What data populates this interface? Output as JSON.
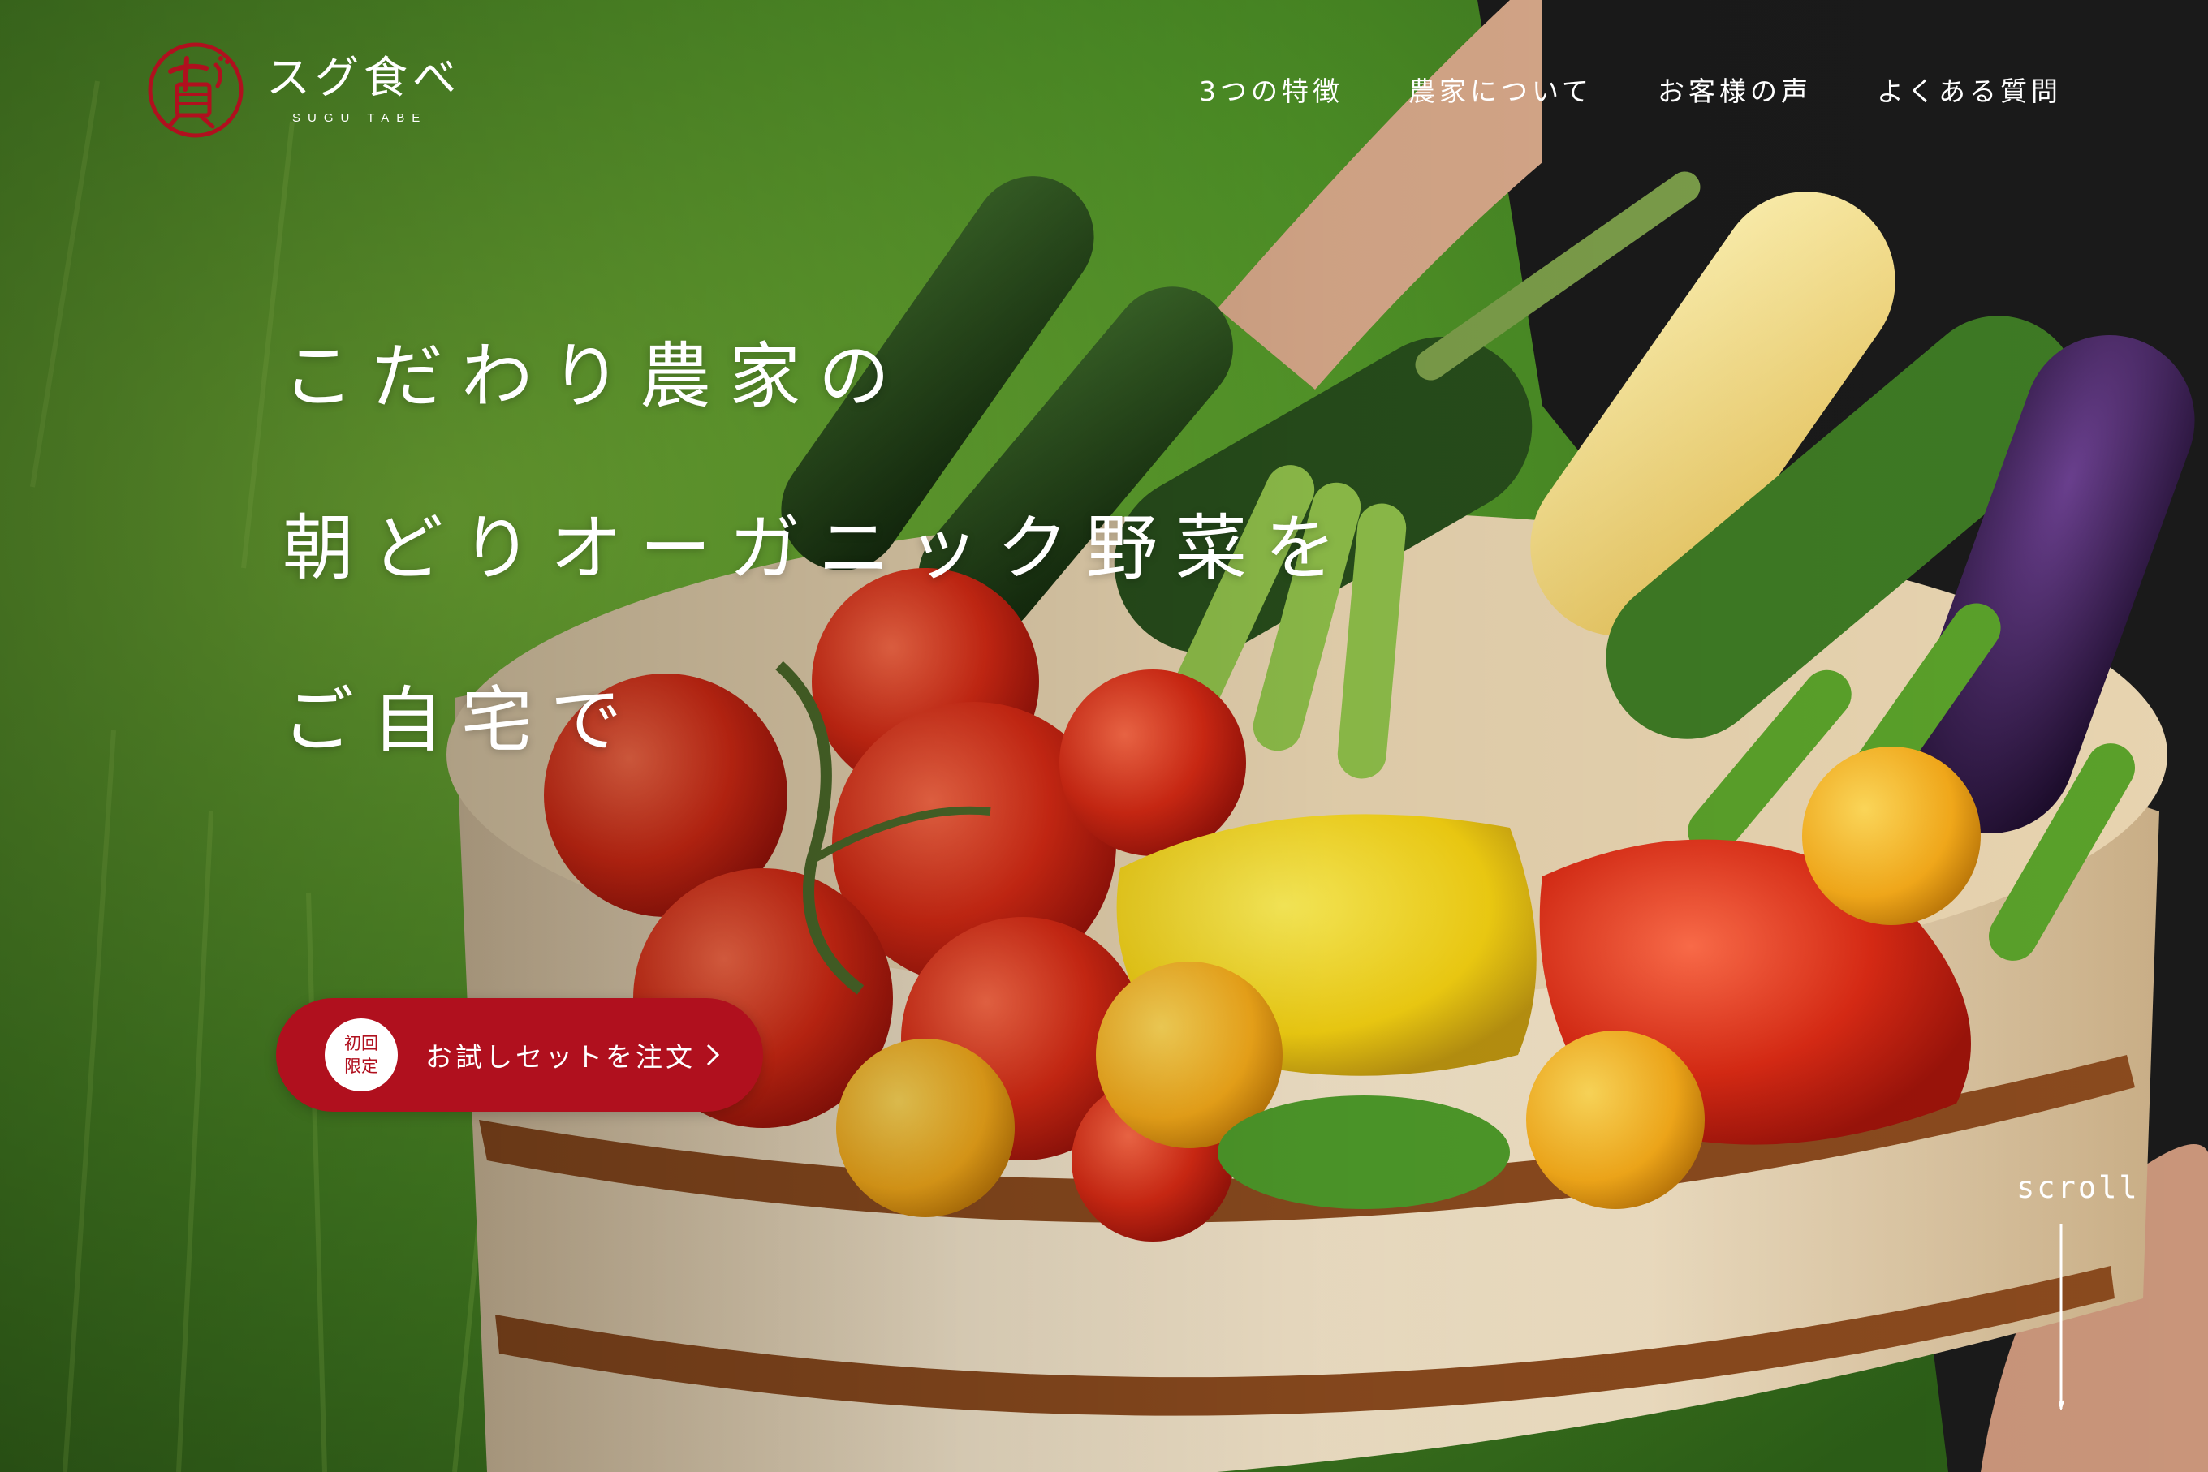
{
  "brand": {
    "name": "スグ食べ",
    "subname": "SUGU TABE",
    "color": "#b0101e"
  },
  "nav": {
    "items": [
      {
        "label": "3つの特徴"
      },
      {
        "label": "農家について"
      },
      {
        "label": "お客様の声"
      },
      {
        "label": "よくある質問"
      }
    ]
  },
  "hero": {
    "lines": [
      "こだわり農家の",
      "朝どりオーガニック野菜を",
      "ご自宅で"
    ]
  },
  "cta": {
    "badge": "初回限定",
    "label": "お試しセットを注文",
    "icon": "chevron-right-icon"
  },
  "scroll": {
    "label": "scroll",
    "icon": "arrow-down-icon"
  }
}
